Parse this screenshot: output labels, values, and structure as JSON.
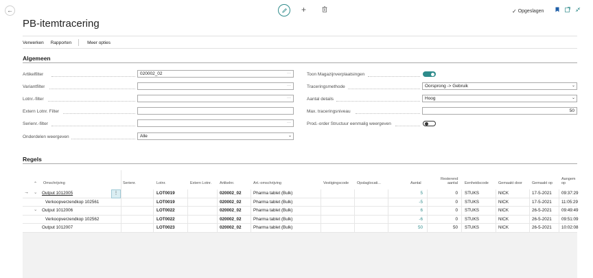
{
  "header": {
    "title": "PB-itemtracering",
    "saved_label": "Opgeslagen",
    "actions": [
      "Verwerken",
      "Rapporten",
      "Meer opties"
    ]
  },
  "general": {
    "title": "Algemeen",
    "left_fields": [
      {
        "label": "Artikelfilter",
        "value": "020002_02",
        "kind": "lookup"
      },
      {
        "label": "Variantfilter",
        "value": "",
        "kind": "lookup"
      },
      {
        "label": "Lotnr.-filter",
        "value": "",
        "kind": "lookup"
      },
      {
        "label": "Extern Lotnr. Filter",
        "value": "",
        "kind": "text"
      },
      {
        "label": "Serienr.-filter",
        "value": "",
        "kind": "lookup"
      },
      {
        "label": "Onderdelen weergeven",
        "value": "Alle",
        "kind": "select"
      }
    ],
    "right_fields": [
      {
        "label": "Toon Magazijnverplaatsingen",
        "value": "on",
        "kind": "toggle"
      },
      {
        "label": "Traceringsmethode",
        "value": "Oorsprong -> Gebruik",
        "kind": "select"
      },
      {
        "label": "Aantal details",
        "value": "Hoog",
        "kind": "select"
      },
      {
        "label": "Max. traceringsniveau",
        "value": "50",
        "kind": "number"
      },
      {
        "label": "Prod.-order Structuur eenmalig weergeven",
        "value": "off",
        "kind": "toggle"
      }
    ]
  },
  "lines": {
    "title": "Regels",
    "columns": {
      "omschrijving": "Omschrijving",
      "serienr": "Serienr.",
      "lotnr": "Lotnr.",
      "extern_lotnr": "Extern Lotnr.",
      "artikelnr": "Artikelnr.",
      "art_omschrijving": "Art.-omschrijving",
      "vestigingscode": "Vestigingscode",
      "opslaglocatie": "Opslaglocati...",
      "aantal": "Aantal",
      "resterend_aantal_1": "Resterend",
      "resterend_aantal_2": "aantal",
      "eenheidscode": "Eenheidscode",
      "gemaakt_door": "Gemaakt door",
      "gemaakt_op": "Gemaakt op",
      "aangemaakt_op_1": "Aangem",
      "aangemaakt_op_2": "op"
    },
    "rows": [
      {
        "omschrijving": "Output 1012005",
        "lotnr": "LOT0019",
        "artikelnr": "020002_02",
        "art_omschrijving": "Pharma tablet (Bulk)",
        "aantal": "5",
        "resterend": "0",
        "eenheid": "STUKS",
        "door": "NICK",
        "op": "17-5-2021",
        "tijd": "09:37:29"
      },
      {
        "omschrijving": "Verkoopverzendkop 102561",
        "lotnr": "LOT0019",
        "artikelnr": "020002_02",
        "art_omschrijving": "Pharma tablet (Bulk)",
        "aantal": "-5",
        "resterend": "0",
        "eenheid": "STUKS",
        "door": "NICK",
        "op": "17-5-2021",
        "tijd": "11:05:29"
      },
      {
        "omschrijving": "Output 1012006",
        "lotnr": "LOT0022",
        "artikelnr": "020002_02",
        "art_omschrijving": "Pharma tablet (Bulk)",
        "aantal": "6",
        "resterend": "0",
        "eenheid": "STUKS",
        "door": "NICK",
        "op": "26-5-2021",
        "tijd": "09:49:49"
      },
      {
        "omschrijving": "Verkoopverzendkop 102562",
        "lotnr": "LOT0022",
        "artikelnr": "020002_02",
        "art_omschrijving": "Pharma tablet (Bulk)",
        "aantal": "-6",
        "resterend": "0",
        "eenheid": "STUKS",
        "door": "NICK",
        "op": "26-5-2021",
        "tijd": "09:51:09"
      },
      {
        "omschrijving": "Output 1012007",
        "lotnr": "LOT0023",
        "artikelnr": "020002_02",
        "art_omschrijving": "Pharma tablet (Bulk)",
        "aantal": "50",
        "resterend": "50",
        "eenheid": "STUKS",
        "door": "NICK",
        "op": "26-5-2021",
        "tijd": "10:02:08"
      }
    ]
  },
  "icons": {
    "back": "back-arrow-icon",
    "edit": "pencil-icon",
    "new": "plus-icon",
    "delete": "trash-icon",
    "bookmark": "bookmark-icon",
    "open_new": "open-in-new-window-icon",
    "collapse": "collapse-icon"
  },
  "colors": {
    "accent": "#2e8b8b",
    "selected_row": "#dbeef3"
  }
}
